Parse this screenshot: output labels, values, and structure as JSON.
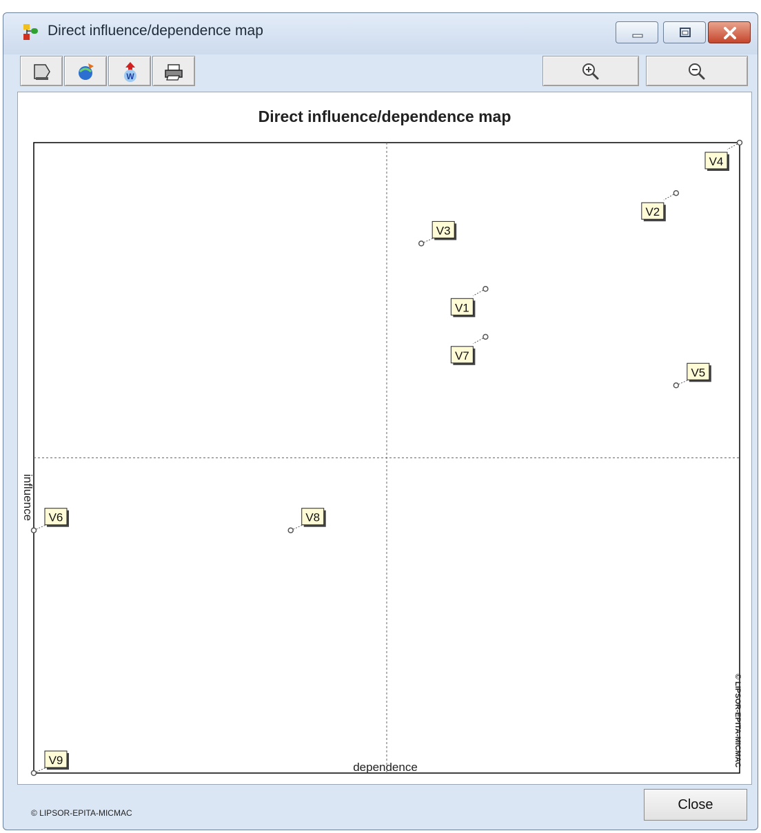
{
  "window": {
    "title": "Direct influence/dependence map",
    "icon": "micmac-app-icon",
    "controls": [
      "minimize-icon",
      "maximize-icon",
      "close-icon"
    ]
  },
  "toolbar": {
    "buttons": [
      {
        "name": "copy-button",
        "icon": "copy-icon"
      },
      {
        "name": "export-button",
        "icon": "export-icon"
      },
      {
        "name": "export-word-button",
        "icon": "word-export-icon"
      },
      {
        "name": "print-button",
        "icon": "printer-icon"
      }
    ],
    "zoom_in_icon": "zoom-in-icon",
    "zoom_out_icon": "zoom-out-icon"
  },
  "chart_data": {
    "type": "scatter",
    "title": "Direct influence/dependence map",
    "xlabel": "dependence",
    "ylabel": "influence",
    "quadrant_lines": {
      "x": 0.5,
      "y": 0.5
    },
    "xlim": [
      0,
      1
    ],
    "ylim": [
      0,
      1
    ],
    "points": [
      {
        "label": "V1",
        "x": 0.64,
        "y": 0.768
      },
      {
        "label": "V2",
        "x": 0.91,
        "y": 0.92
      },
      {
        "label": "V3",
        "x": 0.549,
        "y": 0.84
      },
      {
        "label": "V4",
        "x": 1.0,
        "y": 1.0
      },
      {
        "label": "V5",
        "x": 0.91,
        "y": 0.615
      },
      {
        "label": "V6",
        "x": 0.0,
        "y": 0.385
      },
      {
        "label": "V7",
        "x": 0.64,
        "y": 0.692
      },
      {
        "label": "V8",
        "x": 0.364,
        "y": 0.385
      },
      {
        "label": "V9",
        "x": 0.0,
        "y": 0.0
      }
    ],
    "colors": {
      "label_bg": "#fffbd6",
      "point": "#555555",
      "axis": "#000000"
    }
  },
  "copyright_vertical": "© LIPSOR-EPITA-MICMAC",
  "footer": {
    "copyright": "© LIPSOR-EPITA-MICMAC",
    "close_label": "Close"
  }
}
